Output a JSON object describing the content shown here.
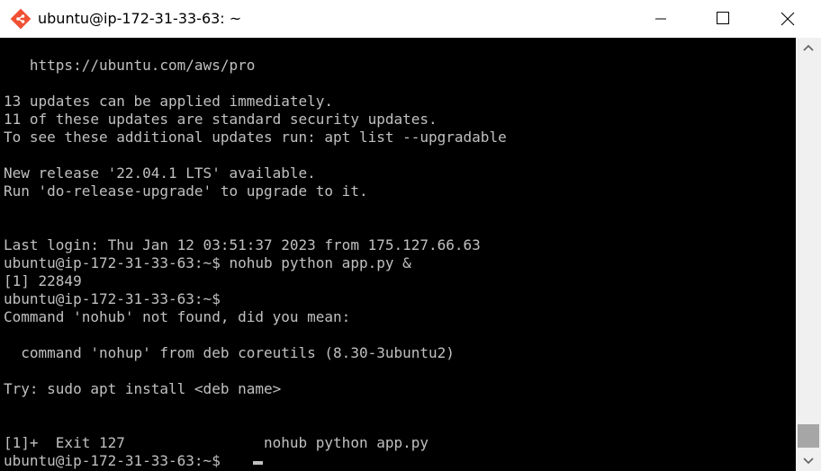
{
  "window": {
    "title": "ubuntu@ip-172-31-33-63: ~",
    "icon": "git-bash-icon",
    "controls": [
      "minimize-icon",
      "maximize-icon",
      "close-icon"
    ]
  },
  "terminal": {
    "lines": [
      "   https://ubuntu.com/aws/pro",
      "",
      "13 updates can be applied immediately.",
      "11 of these updates are standard security updates.",
      "To see these additional updates run: apt list --upgradable",
      "",
      "New release '22.04.1 LTS' available.",
      "Run 'do-release-upgrade' to upgrade to it.",
      "",
      "",
      "Last login: Thu Jan 12 03:51:37 2023 from 175.127.66.63",
      "ubuntu@ip-172-31-33-63:~$ nohub python app.py &",
      "[1] 22849",
      "ubuntu@ip-172-31-33-63:~$",
      "Command 'nohub' not found, did you mean:",
      "",
      "  command 'nohup' from deb coreutils (8.30-3ubuntu2)",
      "",
      "Try: sudo apt install <deb name>",
      "",
      "",
      "[1]+  Exit 127                nohub python app.py",
      "ubuntu@ip-172-31-33-63:~$ "
    ]
  },
  "colors": {
    "terminal_bg": "#000000",
    "terminal_fg": "#c0c0c0",
    "titlebar_bg": "#ffffff",
    "scrollbar_bg": "#f0f0f0",
    "scroll_thumb": "#a6a6a6"
  }
}
